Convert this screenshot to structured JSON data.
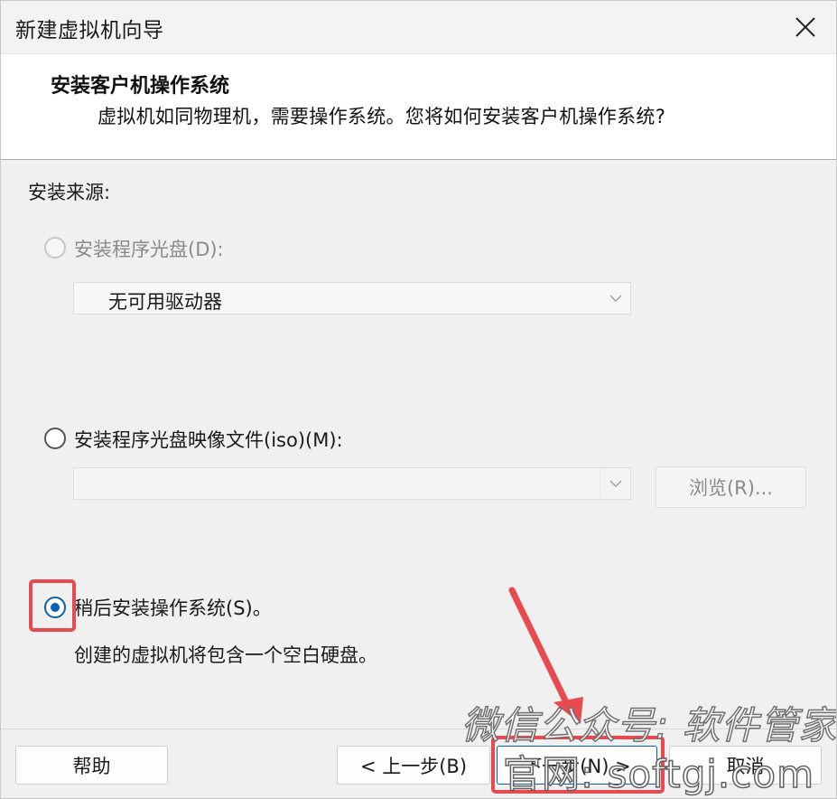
{
  "window": {
    "title": "新建虚拟机向导"
  },
  "header": {
    "title": "安装客户机操作系统",
    "subtitle": "虚拟机如同物理机，需要操作系统。您将如何安装客户机操作系统?"
  },
  "install_source": {
    "label": "安装来源:",
    "disc_option": {
      "label": "安装程序光盘(D):",
      "selected": false,
      "enabled": false
    },
    "disc_drive_select": {
      "value": "无可用驱动器"
    },
    "iso_option": {
      "label": "安装程序光盘映像文件(iso)(M):",
      "selected": false,
      "enabled": true
    },
    "iso_path_select": {
      "value": ""
    },
    "browse_button": {
      "label": "浏览(R)..."
    },
    "later_option": {
      "label": "稍后安装操作系统(S)。",
      "selected": true,
      "description": "创建的虚拟机将包含一个空白硬盘。"
    }
  },
  "footer": {
    "help_label": "帮助",
    "back_label": "< 上一步(B)",
    "next_label": "下一步(N) >",
    "cancel_label": "取消"
  },
  "overlay": {
    "watermark_line1": "微信公众号: 软件管家",
    "watermark_line2": "官网: softgj.com",
    "highlight_color": "#e84a4f"
  }
}
